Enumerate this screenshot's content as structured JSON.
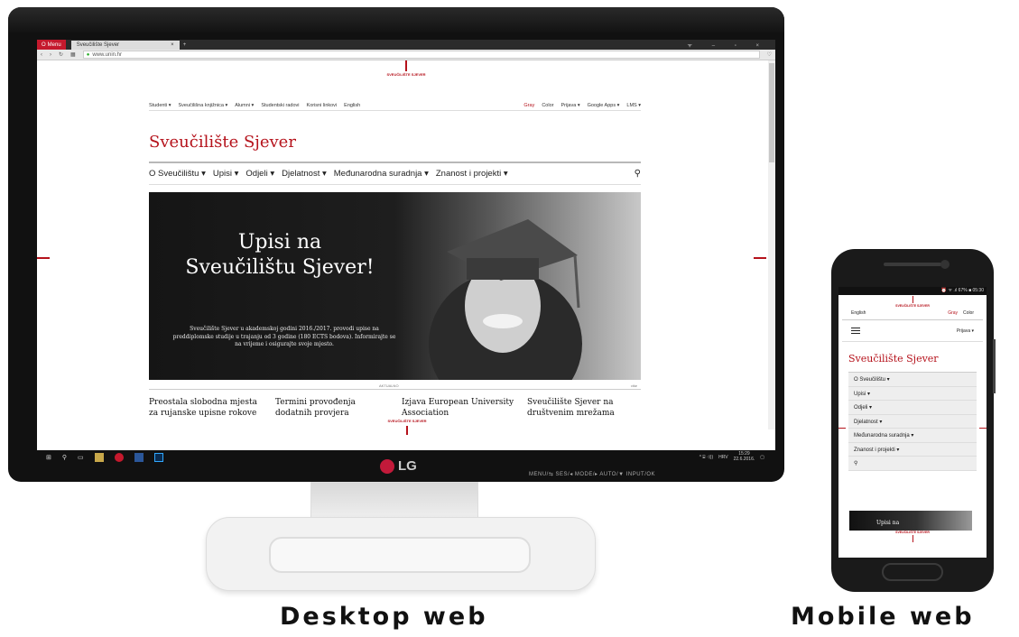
{
  "browser": {
    "menu_label": "Menu",
    "tab_title": "Sveučilište Sjever",
    "tab_close": "×",
    "new_tab": "+",
    "url": "www.unin.hr"
  },
  "site": {
    "logo_text": "SVEUČILIŠTE SJEVER",
    "top_nav": [
      "Studenti ▾",
      "Sveučilišna knjižnica ▾",
      "Alumni ▾",
      "Studentski radovi",
      "Korisni linkovi",
      "English"
    ],
    "top_nav_right": [
      "Gray",
      "Color",
      "Prijava ▾",
      "Google Apps ▾",
      "LMS ▾"
    ],
    "title": "Sveučilište Sjever",
    "main_nav": [
      "O Sveučilištu ▾",
      "Upisi ▾",
      "Odjeli ▾",
      "Djelatnost ▾",
      "Međunarodna suradnja ▾",
      "Znanost i projekti ▾"
    ],
    "search_icon": "⚲",
    "hero_title": "Upisi na Sveučilištu Sjever!",
    "hero_text": "Sveučilište Sjever u akademskoj godini 2016./2017. provodi upise na preddiplomske studije u trajanju od 3 godine (180 ECTS bodova). Informirajte se na vrijeme i osigurajte svoje mjesto.",
    "section_label": "AKTUALNO",
    "section_more": "više",
    "news": [
      "Preostala slobodna mjesta za rujanske upisne rokove",
      "Termini provođenja dodatnih provjera",
      "Izjava European University Association",
      "Sveučilište Sjever na društvenim mrežama"
    ]
  },
  "taskbar": {
    "tray_lang": "HRV",
    "time": "15:29",
    "date": "22.6.2016."
  },
  "monitor": {
    "brand": "LG",
    "buttons": "MENU/⇆   SES/◂   MODE/▸   AUTO/▼   INPUT/OK"
  },
  "phone": {
    "status": "⏰ ᯤ .ıl 67% ■ 05:30",
    "lang": "English",
    "gray": "Gray",
    "color": "Color",
    "login": "Prijava ▾",
    "title": "Sveučilište Sjever",
    "menu": [
      "O Sveučilištu ▾",
      "Upisi ▾",
      "Odjeli ▾",
      "Djelatnost ▾",
      "Međunarodna suradnja ▾",
      "Znanost i projekti ▾"
    ],
    "search_icon": "⚲",
    "hero_text": "Upisi na"
  },
  "captions": {
    "desktop": "Desktop web",
    "mobile": "Mobile web"
  },
  "colors": {
    "brand_red": "#b5121b"
  }
}
